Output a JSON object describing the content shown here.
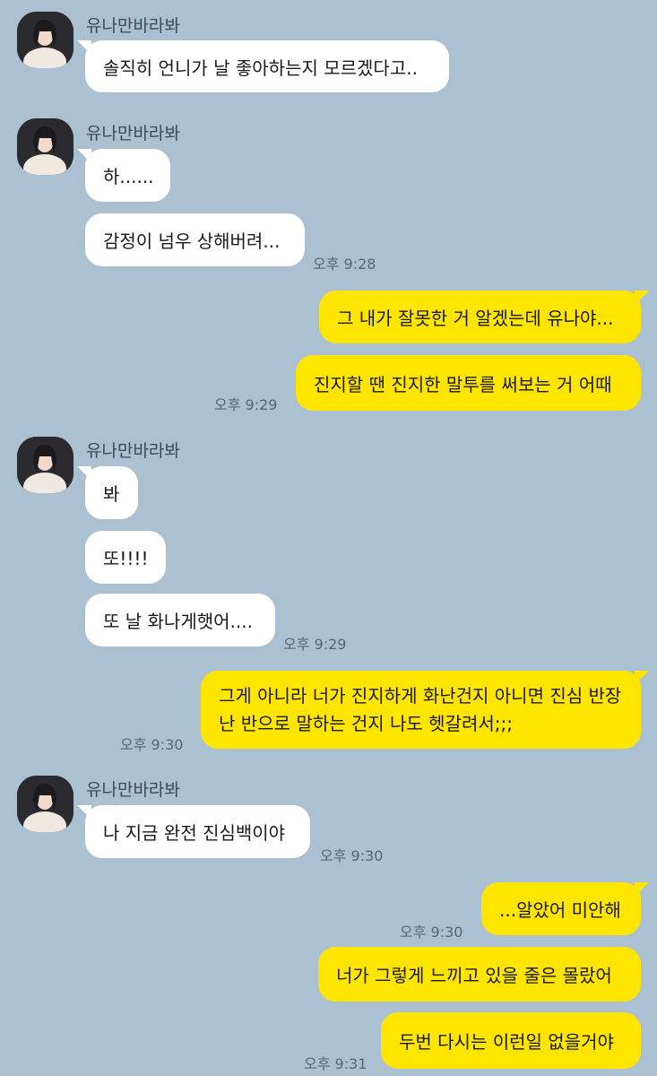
{
  "sender_name": "유나만바라봐",
  "messages": {
    "m1": "솔직히 언니가 날 좋아하는지 모르겠다고..",
    "m2": "하......",
    "m3": "감정이 넘우 상해버려...",
    "m4": "그 내가 잘못한 거 알겠는데 유나야...",
    "m5": "진지할 땐 진지한 말투를 써보는 거 어때",
    "m6": "봐",
    "m7": "또!!!!",
    "m8": "또 날 화나게햇어....",
    "m9": "그게 아니라 너가 진지하게 화난건지 아니면 진심 반장난 반으로 말하는 건지 나도 헷갈려서;;;",
    "m10": "나 지금 완전 진심백이야",
    "m11": "...알았어 미안해",
    "m12": "너가 그렇게 느끼고 있을 줄은 몰랐어",
    "m13": "두번 다시는 이런일 없을거야"
  },
  "times": {
    "t1": "오후 9:28",
    "t2": "오후 9:29",
    "t3": "오후 9:29",
    "t4": "오후 9:30",
    "t5": "오후 9:30",
    "t6": "오후 9:30",
    "t7": "오후 9:31"
  },
  "colors": {
    "background": "#abc1d1",
    "incoming_bubble": "#ffffff",
    "outgoing_bubble": "#fee500"
  }
}
